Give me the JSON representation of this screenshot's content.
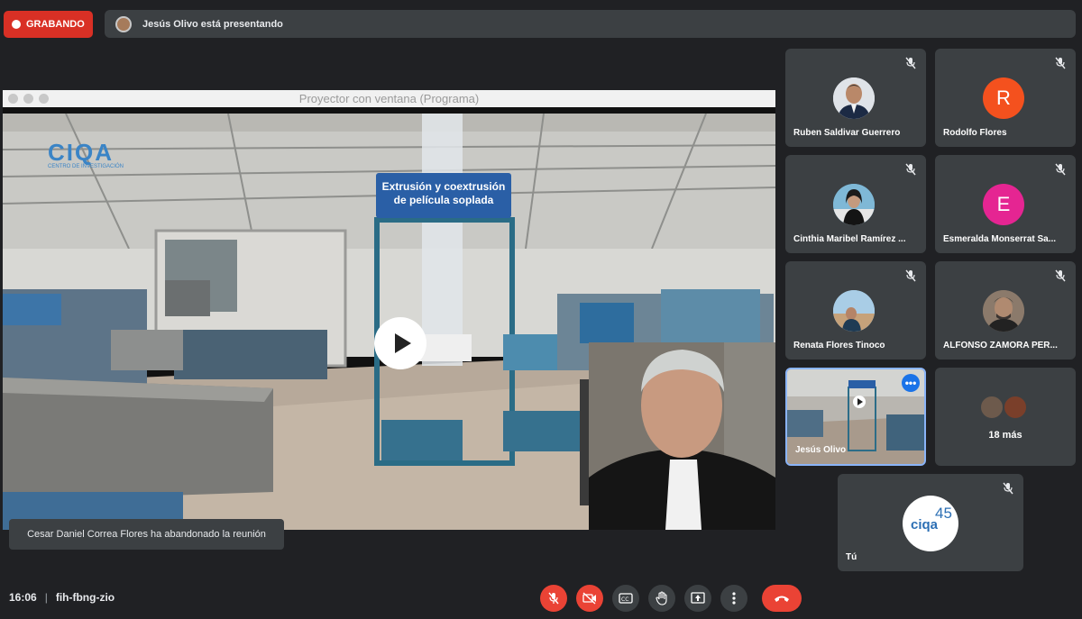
{
  "recording": {
    "label": "GRABANDO"
  },
  "presenter_banner": {
    "text": "Jesús Olivo está presentando"
  },
  "shared_window": {
    "title": "Proyector con ventana (Programa)",
    "sign_line1": "Extrusión y coextrusión",
    "sign_line2": "de película soplada",
    "logo_text": "CIQA",
    "logo_sub": "CENTRO DE INVESTIGACIÓN"
  },
  "toast": {
    "text": "Cesar Daniel Correa Flores ha abandonado la reunión"
  },
  "participants": [
    {
      "name": "Ruben Saldivar Guerrero",
      "avatar": "photo",
      "muted": true
    },
    {
      "name": "Rodolfo Flores",
      "avatar": "R",
      "avatar_color": "#f4511e",
      "muted": true
    },
    {
      "name": "Cinthia Maribel Ramírez ...",
      "avatar": "photo",
      "muted": true
    },
    {
      "name": "Esmeralda Monserrat Sa...",
      "avatar": "E",
      "avatar_color": "#e52592",
      "muted": true
    },
    {
      "name": "Renata Flores Tinoco",
      "avatar": "photo",
      "muted": true
    },
    {
      "name": "ALFONSO ZAMORA PER...",
      "avatar": "photo",
      "muted": true
    },
    {
      "name": "Jesús Olivo",
      "avatar": "presentation-thumbnail",
      "muted": false
    },
    {
      "name": "18 más",
      "avatar": "group",
      "muted": false
    },
    {
      "name": "Tú",
      "avatar": "ciqa-45-logo",
      "muted": true
    }
  ],
  "self_logo": {
    "text": "ciqa",
    "number": "45"
  },
  "footer": {
    "time": "16:06",
    "separator": "|",
    "meeting_code": "fih-fbng-zio"
  },
  "controls": [
    "mic-off-icon",
    "camera-off-icon",
    "captions-icon",
    "raise-hand-icon",
    "present-icon",
    "more-options-icon",
    "end-call-icon"
  ],
  "colors": {
    "background": "#202124",
    "tile": "#3c4043",
    "danger": "#ea4335",
    "record": "#d93025",
    "accent": "#8ab4f8"
  }
}
